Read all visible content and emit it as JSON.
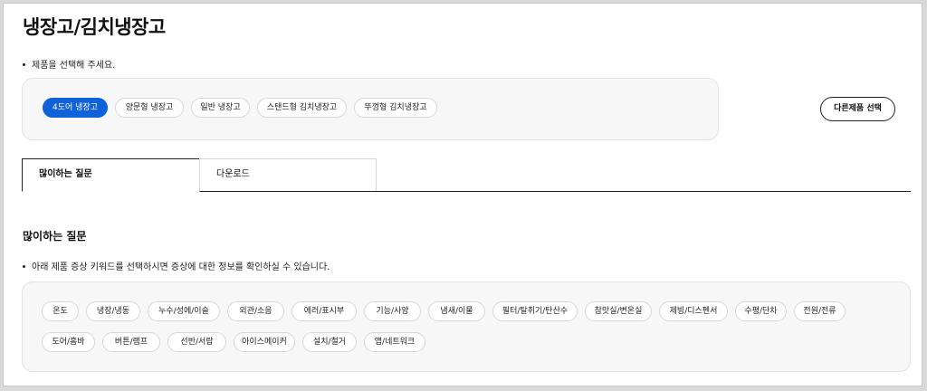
{
  "page": {
    "title": "냉장고/김치냉장고"
  },
  "product_select": {
    "hint": "제품을 선택해 주세요.",
    "chips": [
      {
        "label": "4도어 냉장고",
        "active": true
      },
      {
        "label": "양문형 냉장고",
        "active": false
      },
      {
        "label": "일반 냉장고",
        "active": false
      },
      {
        "label": "스탠드형 김치냉장고",
        "active": false
      },
      {
        "label": "뚜껑형 김치냉장고",
        "active": false
      }
    ],
    "other_button": "다른제품 선택"
  },
  "tabs": [
    {
      "label": "많이하는 질문",
      "active": true
    },
    {
      "label": "다운로드",
      "active": false
    }
  ],
  "faq": {
    "title": "많이하는 질문",
    "hint": "아래 제품 증상 키워드를 선택하시면 증상에 대한 정보를 확인하실 수 있습니다.",
    "keywords_row1": [
      "온도",
      "냉장/냉동",
      "누수/성에/이슬",
      "외관/소음",
      "에러/표시부",
      "기능/사양",
      "냄새/이물",
      "필터/탈취기/탄산수",
      "참맛실/변온실",
      "제빙/디스펜서",
      "수평/단차",
      "전원/전류"
    ],
    "keywords_row2": [
      "도어/홈바",
      "버튼/램프",
      "선반/서랍",
      "아이스메이커",
      "설치/철거",
      "앱/네트워크"
    ]
  },
  "colors": {
    "accent": "#0f62d9",
    "panel": "#f7f7f7",
    "border": "#e3e3e3"
  }
}
